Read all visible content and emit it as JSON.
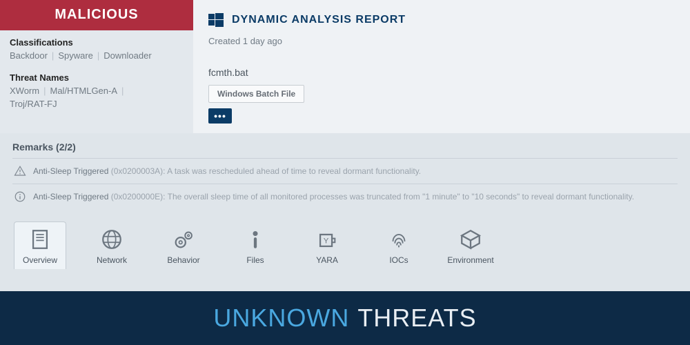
{
  "verdict": {
    "label": "MALICIOUS",
    "classifications_label": "Classifications",
    "classifications": [
      "Backdoor",
      "Spyware",
      "Downloader"
    ],
    "threat_names_label": "Threat Names",
    "threat_names": [
      "XWorm",
      "Mal/HTMLGen-A",
      "Troj/RAT-FJ"
    ]
  },
  "report": {
    "title": "DYNAMIC ANALYSIS REPORT",
    "created": "Created 1 day ago",
    "filename": "fcmth.bat",
    "filetype": "Windows Batch File",
    "more_label": "•••"
  },
  "remarks": {
    "header": "Remarks (2/2)",
    "items": [
      {
        "icon": "warning",
        "title": "Anti-Sleep Triggered",
        "code": "(0x0200003A):",
        "text": "A task was rescheduled ahead of time to reveal dormant functionality."
      },
      {
        "icon": "info",
        "title": "Anti-Sleep Triggered",
        "code": "(0x0200000E):",
        "text": "The overall sleep time of all monitored processes was truncated from \"1 minute\" to \"10 seconds\" to reveal dormant functionality."
      }
    ]
  },
  "tabs": [
    {
      "id": "overview",
      "label": "Overview",
      "active": true
    },
    {
      "id": "network",
      "label": "Network",
      "active": false
    },
    {
      "id": "behavior",
      "label": "Behavior",
      "active": false
    },
    {
      "id": "files",
      "label": "Files",
      "active": false
    },
    {
      "id": "yara",
      "label": "YARA",
      "active": false
    },
    {
      "id": "iocs",
      "label": "IOCs",
      "active": false
    },
    {
      "id": "environment",
      "label": "Environment",
      "active": false
    }
  ],
  "footer": {
    "word1": "UNKNOWN",
    "word2": "THREATS"
  },
  "colors": {
    "verdict_bg": "#ae2d3f",
    "accent_dark": "#0b3b66",
    "footer_bg": "#0d2a46",
    "footer_accent": "#4aa8e0"
  }
}
